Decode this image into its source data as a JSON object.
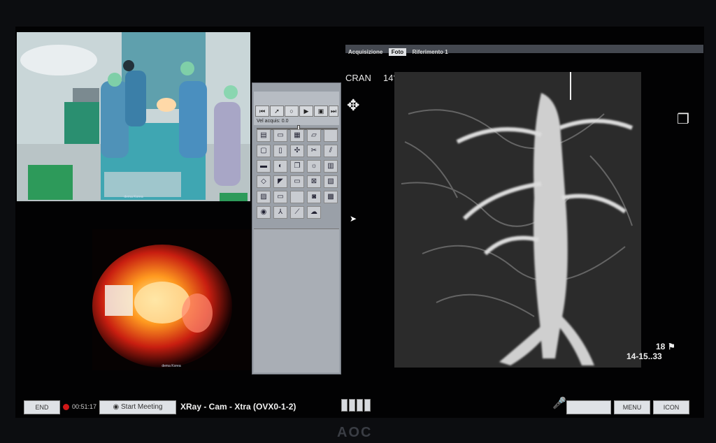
{
  "monitor": {
    "brand": "AOC"
  },
  "cameras": {
    "room_caption": "dema Korea",
    "field_caption": "dema Korea"
  },
  "tool_panel": {
    "transport_icons": [
      "skip-back-icon",
      "pointer-icon",
      "circle-icon",
      "play-icon",
      "record-icon",
      "skip-forward-icon"
    ],
    "velocity_label": "Vel acquis: 0.0",
    "tool_icons": [
      "real-icon",
      "folder-icon",
      "mem-icon",
      "folder-open-icon",
      "blank-icon",
      "monitor-icon",
      "document-icon",
      "crosshair-icon",
      "scissors-icon",
      "split-icon",
      "ruler-icon",
      "contrast-icon",
      "copy-icon",
      "sun-icon",
      "film-icon",
      "diamond-icon",
      "pistol-icon",
      "folder-icon",
      "close-box-icon",
      "layers-icon",
      "image-icon",
      "export-icon",
      "camera-icon",
      "disk-icon",
      "table-icon",
      "eye-icon",
      "triad-icon",
      "wrench-icon",
      "cloud-icon"
    ]
  },
  "viewer": {
    "tabs": [
      "Acquisizione",
      "Foto",
      "Riferimento 1"
    ],
    "active_tab": 1,
    "orientation": "CRAN",
    "angle": "14°",
    "frame": "18",
    "time": "14-15..33"
  },
  "bottom_bar": {
    "end_label": "END",
    "timer": "00:51:17",
    "start_meeting_label": "Start Meeting",
    "session_title": "XRay - Cam - Xtra (OVX0-1-2)",
    "menu_label": "MENU",
    "icon_label": "ICON",
    "input_value": ""
  },
  "colors": {
    "record": "#d01818",
    "panel": "#9aa0a8",
    "screen": "#020203"
  }
}
